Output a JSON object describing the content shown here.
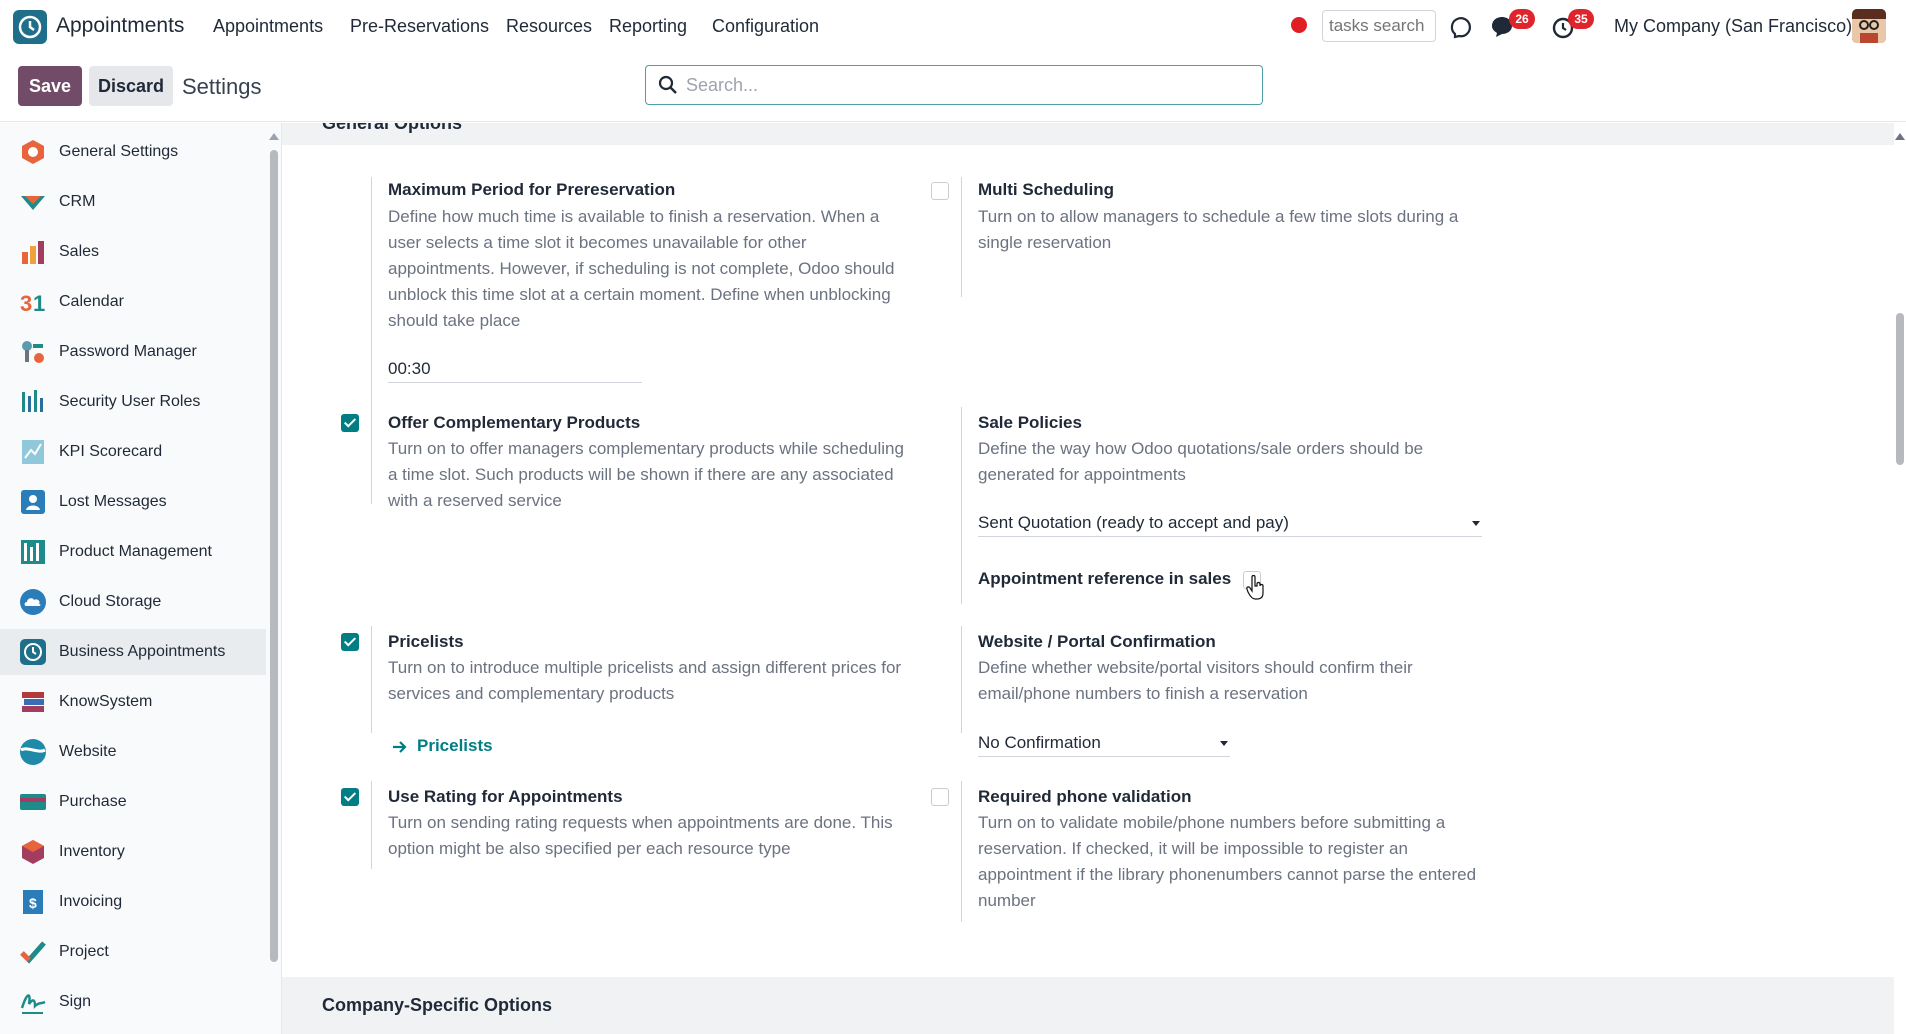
{
  "navbar": {
    "app_name": "Appointments",
    "menus": [
      "Appointments",
      "Pre-Reservations",
      "Resources",
      "Reporting",
      "Configuration"
    ],
    "tasks_search_placeholder": "tasks search",
    "messages_count": "26",
    "activities_count": "35",
    "company": "My Company (San Francisco)"
  },
  "control": {
    "save_label": "Save",
    "discard_label": "Discard",
    "title": "Settings",
    "search_placeholder": "Search..."
  },
  "sidebar": {
    "items": [
      {
        "label": "General Settings",
        "icon": "general-settings-icon"
      },
      {
        "label": "CRM",
        "icon": "crm-icon"
      },
      {
        "label": "Sales",
        "icon": "sales-icon"
      },
      {
        "label": "Calendar",
        "icon": "calendar-icon"
      },
      {
        "label": "Password Manager",
        "icon": "password-manager-icon"
      },
      {
        "label": "Security User Roles",
        "icon": "security-user-roles-icon"
      },
      {
        "label": "KPI Scorecard",
        "icon": "kpi-scorecard-icon"
      },
      {
        "label": "Lost Messages",
        "icon": "lost-messages-icon"
      },
      {
        "label": "Product Management",
        "icon": "product-management-icon"
      },
      {
        "label": "Cloud Storage",
        "icon": "cloud-storage-icon"
      },
      {
        "label": "Business Appointments",
        "icon": "business-appointments-icon",
        "active": true
      },
      {
        "label": "KnowSystem",
        "icon": "knowsystem-icon"
      },
      {
        "label": "Website",
        "icon": "website-icon"
      },
      {
        "label": "Purchase",
        "icon": "purchase-icon"
      },
      {
        "label": "Inventory",
        "icon": "inventory-icon"
      },
      {
        "label": "Invoicing",
        "icon": "invoicing-icon"
      },
      {
        "label": "Project",
        "icon": "project-icon"
      },
      {
        "label": "Sign",
        "icon": "sign-icon"
      }
    ]
  },
  "sections": {
    "general": "General Options",
    "company": "Company-Specific Options"
  },
  "settings": {
    "max_period": {
      "title": "Maximum Period for Prereservation",
      "desc": "Define how much time is available to finish a reservation. When a user selects a time slot it becomes unavailable for other appointments. However, if scheduling is not complete, Odoo should unblock this time slot at a certain moment. Define when unblocking should take place",
      "value": "00:30"
    },
    "multi_scheduling": {
      "title": "Multi Scheduling",
      "desc": "Turn on to allow managers to schedule a few time slots during a single reservation",
      "checked": false
    },
    "complementary": {
      "title": "Offer Complementary Products",
      "desc": "Turn on to offer managers complementary products while scheduling a time slot. Such products will be shown if there are any associated with a reserved service",
      "checked": true
    },
    "sale_policies": {
      "title": "Sale Policies",
      "desc": "Define the way how Odoo quotations/sale orders should be generated for appointments",
      "value": "Sent Quotation (ready to accept and pay)",
      "ref_label": "Appointment reference in sales",
      "ref_checked": false
    },
    "pricelists": {
      "title": "Pricelists",
      "desc": "Turn on to introduce multiple pricelists and assign different prices for services and complementary products",
      "link": "Pricelists",
      "checked": true
    },
    "portal_confirmation": {
      "title": "Website / Portal Confirmation",
      "desc": "Define whether website/portal visitors should confirm their email/phone numbers to finish a reservation",
      "value": "No Confirmation"
    },
    "rating": {
      "title": "Use Rating for Appointments",
      "desc": "Turn on sending rating requests when appointments are done. This option might be also specified per each resource type",
      "checked": true
    },
    "phone_validation": {
      "title": "Required phone validation",
      "desc": "Turn on to validate mobile/phone numbers before submitting a reservation. If checked, it will be impossible to register an appointment if the library phonenumbers cannot parse the entered number",
      "checked": false
    }
  }
}
